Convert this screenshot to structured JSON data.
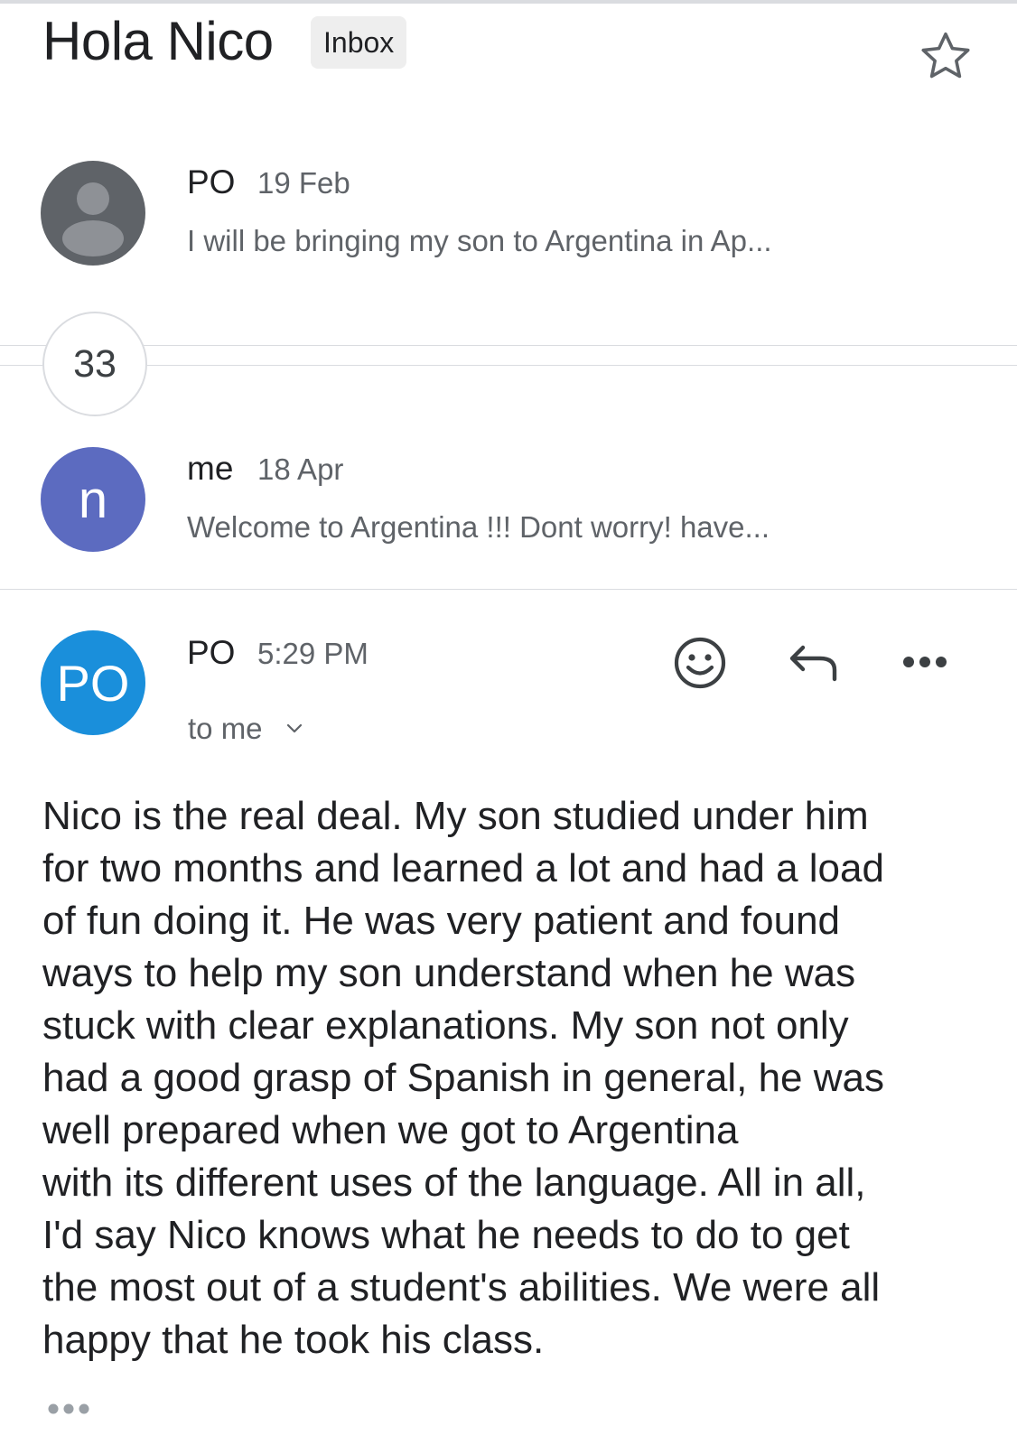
{
  "thread": {
    "subject": "Hola Nico",
    "label": "Inbox"
  },
  "messages": [
    {
      "sender": "PO",
      "date": "19 Feb",
      "snippet": "I will be bringing my son to Argentina in Ap...",
      "avatar_color": "#5f6368"
    },
    {
      "sender": "me",
      "date": "18 Apr",
      "snippet": "Welcome to Argentina !!! Dont worry! have...",
      "avatar_letter": "n",
      "avatar_color": "#5c6bc0"
    }
  ],
  "collapsed_count": "33",
  "open_message": {
    "sender": "PO",
    "avatar_initials": "PO",
    "avatar_color": "#1a8fdb",
    "time": "5:29 PM",
    "recipients": "to me",
    "body_lines": [
      "Nico is the real deal. My son studied under him",
      "for two months and learned a lot and had a load",
      "of fun doing it. He was very patient and found",
      "ways to help my son understand when he was",
      "stuck with clear explanations. My son not only",
      "had a good grasp of Spanish in general, he was",
      "well prepared when we got to Argentina",
      "with its different uses of the language. All in all,",
      "I'd say Nico knows what he needs to do to get",
      "the most out of a student's abilities. We were all",
      "happy that he took his class."
    ]
  },
  "icons": {
    "star": "star-icon",
    "emoji": "emoji-react-icon",
    "reply": "reply-icon",
    "more": "more-options-icon",
    "expand": "chevron-down-icon",
    "show_trimmed": "show-trimmed-content-icon"
  }
}
